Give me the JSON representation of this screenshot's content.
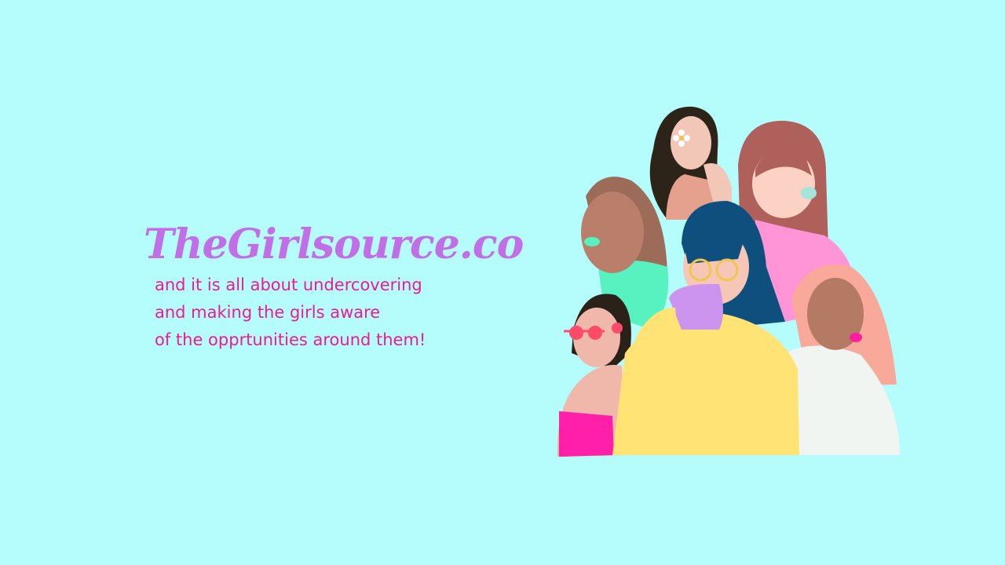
{
  "brand": {
    "title": "TheGirlsource.co"
  },
  "tagline": {
    "lines": [
      "and it is all about undercovering",
      "and making the girls aware",
      "of the opprtunities around them!"
    ]
  },
  "illustration": {
    "subject": "group-of-women-icon"
  },
  "colors": {
    "background": "#b5fcfc",
    "title": "#c26ee6",
    "tagline": "#ea1a9a"
  }
}
